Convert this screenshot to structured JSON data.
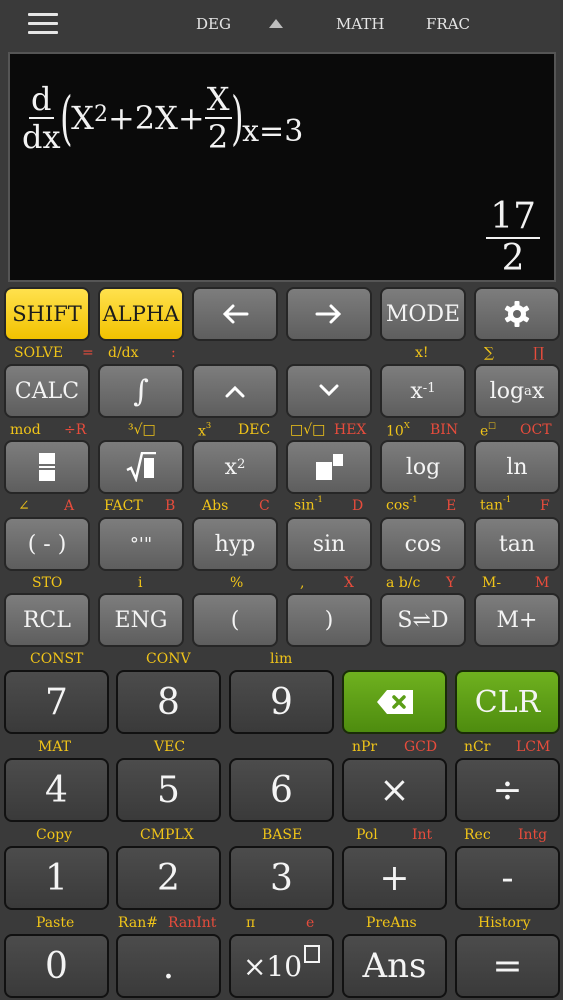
{
  "topbar": {
    "deg": "DEG",
    "math": "MATH",
    "frac": "FRAC"
  },
  "display": {
    "d_num": "d",
    "d_den": "dx",
    "term1": "X",
    "term1_exp": "2",
    "term2": "+2X+",
    "half_num": "X",
    "half_den": "2",
    "eval": "x=3",
    "result_num": "17",
    "result_den": "2"
  },
  "row1": {
    "shift": "SHIFT",
    "alpha": "ALPHA",
    "mode": "MODE"
  },
  "row2": {
    "calc": "CALC",
    "integral": "∫",
    "log_base": "log",
    "log_sub": "a",
    "log_arg": "x",
    "x_inv": "x",
    "x_inv_exp": "-1"
  },
  "row3": {
    "x2": "x",
    "x2_exp": "2",
    "log": "log",
    "ln": "ln"
  },
  "row4": {
    "neg": "( - )",
    "dms": "°'\"",
    "hyp": "hyp",
    "sin": "sin",
    "cos": "cos",
    "tan": "tan"
  },
  "row5": {
    "rcl": "RCL",
    "eng": "ENG",
    "lparen": "(",
    "rparen": ")",
    "sd": "S⇌D",
    "mplus": "M+"
  },
  "row6": {
    "k7": "7",
    "k8": "8",
    "k9": "9",
    "clr": "CLR"
  },
  "row7": {
    "k4": "4",
    "k5": "5",
    "k6": "6",
    "mul": "×",
    "div": "÷"
  },
  "row8": {
    "k1": "1",
    "k2": "2",
    "k3": "3",
    "plus": "+",
    "minus": "-"
  },
  "row9": {
    "k0": "0",
    "dot": ".",
    "x10": "×10",
    "ans": "Ans",
    "eq": "="
  },
  "labels": {
    "solve": "SOLVE",
    "eq_sign": "=",
    "ddx": "d/dx",
    "colon": ":",
    "fact_x": "x!",
    "sigma": "∑",
    "pi_prod": "∏",
    "mod": "mod",
    "div_r": "÷R",
    "cbrt": "³√□",
    "x3": "x",
    "x3_exp": "3",
    "dec": "DEC",
    "nroot": "□√□",
    "hex": "HEX",
    "ten_x": "10",
    "ten_x_exp": "X",
    "bin": "BIN",
    "e_x": "e",
    "e_x_exp": "□",
    "oct": "OCT",
    "angle": "∠",
    "a": "A",
    "fact": "FACT",
    "b": "B",
    "abs": "Abs",
    "c": "C",
    "sin_inv": "sin",
    "sin_inv_exp": "-1",
    "d": "D",
    "cos_inv": "cos",
    "cos_inv_exp": "-1",
    "e": "E",
    "tan_inv": "tan",
    "tan_inv_exp": "-1",
    "f": "F",
    "sto": "STO",
    "i": "i",
    "percent": "%",
    "comma": ",",
    "x": "X",
    "abc": "a b/c",
    "y": "Y",
    "mminus": "M-",
    "m": "M",
    "const": "CONST",
    "conv": "CONV",
    "lim": "lim",
    "mat": "MAT",
    "vec": "VEC",
    "npr": "nPr",
    "gcd": "GCD",
    "ncr": "nCr",
    "lcm": "LCM",
    "copy": "Copy",
    "cmplx": "CMPLX",
    "base": "BASE",
    "pol": "Pol",
    "int": "Int",
    "rec": "Rec",
    "intg": "Intg",
    "paste": "Paste",
    "ran": "Ran#",
    "ranint": "RanInt",
    "pi": "π",
    "e_const": "e",
    "preans": "PreAns",
    "history": "History"
  },
  "colors": {
    "label_yellow": "#f0c419",
    "label_red": "#e74c3c",
    "green_key": "#5b9e17",
    "yellow_key": "#f5c800"
  }
}
